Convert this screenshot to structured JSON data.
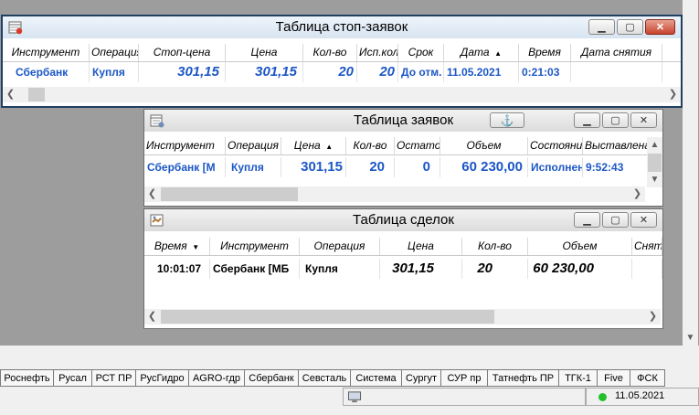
{
  "stop_orders": {
    "title": "Таблица стоп-заявок",
    "columns": [
      "Инструмент",
      "Операция",
      "Стоп-цена",
      "Цена",
      "Кол-во",
      "Исп.кол",
      "Срок",
      "Дата",
      "Время",
      "Дата снятия"
    ],
    "row": {
      "instrument": "Сбербанк",
      "operation": "Купля",
      "stop_price": "301,15",
      "price": "301,15",
      "qty": "20",
      "exec_qty": "20",
      "term": "До отм.",
      "date": "11.05.2021",
      "time": "0:21:03",
      "cancel_date": ""
    }
  },
  "orders": {
    "title": "Таблица заявок",
    "columns": [
      "Инструмент",
      "Операция",
      "Цена",
      "Кол-во",
      "Остаток",
      "Объем",
      "Состояние",
      "Выставлена"
    ],
    "row": {
      "instrument": "Сбербанк [М",
      "operation": "Купля",
      "price": "301,15",
      "qty": "20",
      "rest": "0",
      "volume": "60 230,00",
      "state": "Исполнена",
      "placed": "9:52:43"
    }
  },
  "trades": {
    "title": "Таблица сделок",
    "columns": [
      "Время",
      "Инструмент",
      "Операция",
      "Цена",
      "Кол-во",
      "Объем",
      "Снята(вр"
    ],
    "row": {
      "time": "10:01:07",
      "instrument": "Сбербанк [МБ",
      "operation": "Купля",
      "price": "301,15",
      "qty": "20",
      "volume": "60 230,00",
      "removed": ""
    }
  },
  "tabs": [
    "Роснефть",
    "Русал",
    "РСТ ПР",
    "РусГидро",
    "AGRO-гдр",
    "Сбербанк",
    "Севсталь",
    "Система",
    "Сургут",
    "СУР пр",
    "Татнефть ПР",
    "ТГК-1",
    "Five",
    "ФСК"
  ],
  "status": {
    "date": "11.05.2021",
    "connection_color": "#22c02a"
  },
  "colors": {
    "accent_blue": "#1c57c6",
    "close_red": "#c8442d"
  }
}
